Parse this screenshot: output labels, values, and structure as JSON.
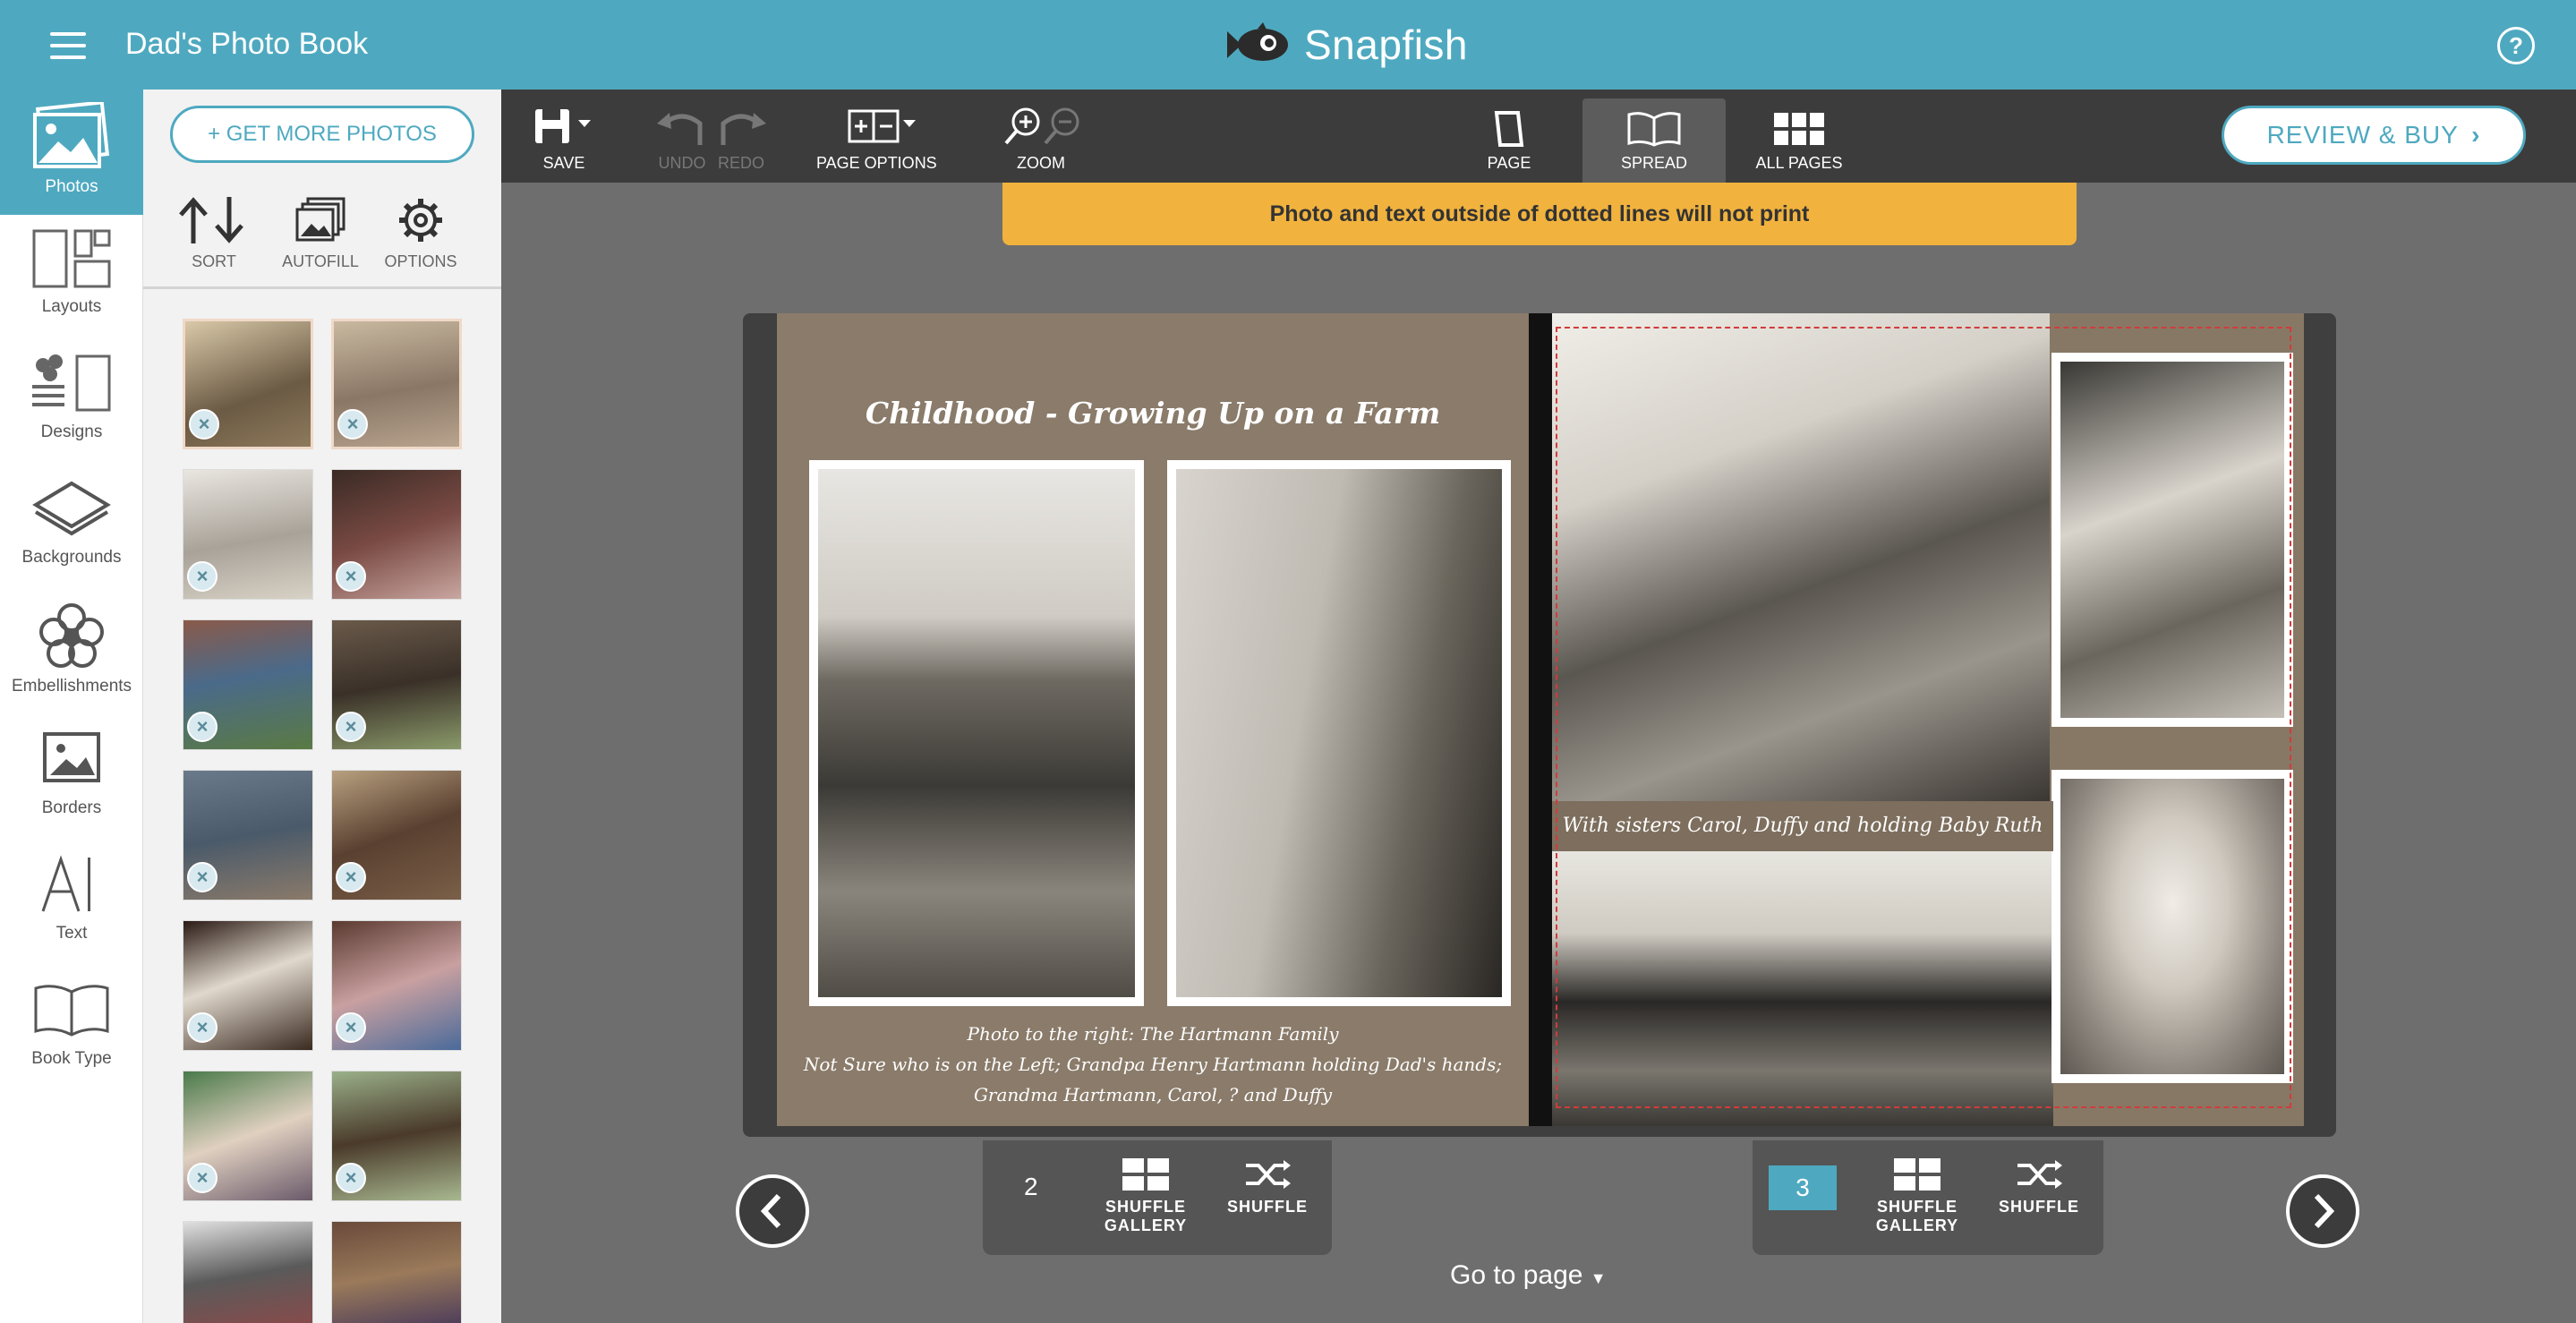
{
  "header": {
    "book_title": "Dad's Photo Book",
    "brand": "Snapfish",
    "help_label": "?"
  },
  "rail": {
    "items": [
      {
        "label": "Photos",
        "icon": "photos-icon",
        "active": true
      },
      {
        "label": "Layouts",
        "icon": "layouts-icon"
      },
      {
        "label": "Designs",
        "icon": "designs-icon"
      },
      {
        "label": "Backgrounds",
        "icon": "backgrounds-icon"
      },
      {
        "label": "Embellishments",
        "icon": "flower-icon"
      },
      {
        "label": "Borders",
        "icon": "borders-icon"
      },
      {
        "label": "Text",
        "icon": "text-icon"
      },
      {
        "label": "Book Type",
        "icon": "book-icon"
      }
    ]
  },
  "panel": {
    "get_more": "+ GET MORE PHOTOS",
    "tools": [
      {
        "label": "SORT",
        "icon": "sort-icon"
      },
      {
        "label": "AUTOFILL",
        "icon": "autofill-icon"
      },
      {
        "label": "OPTIONS",
        "icon": "gear-icon"
      }
    ],
    "remove_label": "×"
  },
  "toolbar": {
    "save": "SAVE",
    "undo": "UNDO",
    "redo": "REDO",
    "page_options": "PAGE OPTIONS",
    "zoom": "ZOOM",
    "view_page": "PAGE",
    "view_spread": "SPREAD",
    "view_all": "ALL PAGES",
    "review": "REVIEW & BUY"
  },
  "banner": "Photo and text outside of dotted lines will not print",
  "spread": {
    "left_title": "Childhood - Growing Up on a Farm",
    "left_caption_1": "Photo to the right: The Hartmann Family",
    "left_caption_2": "Not Sure who is on the Left; Grandpa Henry Hartmann holding Dad's hands;",
    "left_caption_3": "Grandma Hartmann, Carol, ? and Duffy",
    "right_caption": "With sisters Carol, Duffy and holding Baby Ruth"
  },
  "bottom": {
    "left_page_num": "2",
    "right_page_num": "3",
    "shuffle_gallery_1": "SHUFFLE",
    "shuffle_gallery_2": "GALLERY",
    "shuffle": "SHUFFLE",
    "goto": "Go to page"
  },
  "colors": {
    "accent": "#4ea9c0",
    "banner": "#f1b33e",
    "toolbar": "#3c3c3c"
  }
}
